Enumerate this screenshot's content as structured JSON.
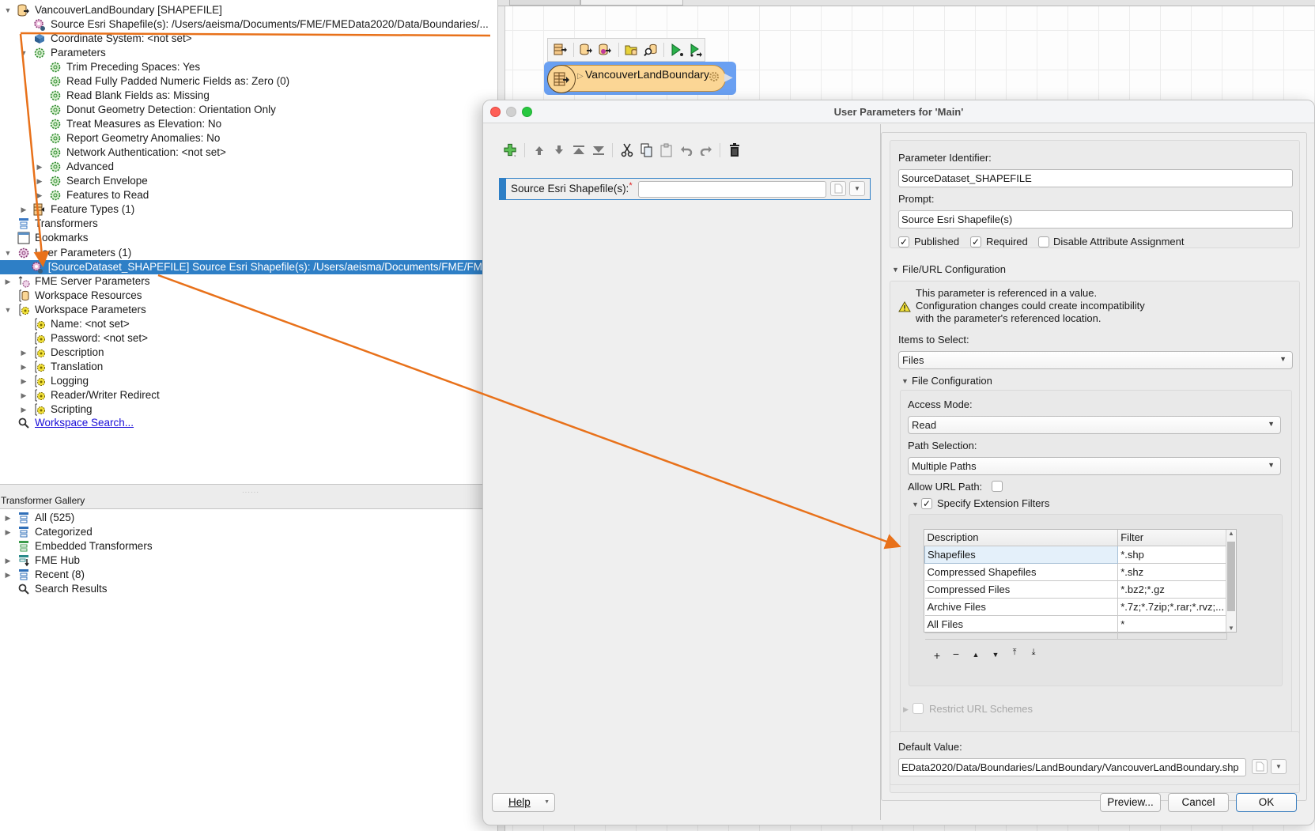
{
  "navigator": {
    "items": [
      {
        "label": "VancouverLandBoundary [SHAPEFILE]",
        "icon": "reader-icon",
        "expanded": true,
        "level": 0
      },
      {
        "label": "Source Esri Shapefile(s): /Users/aeisma/Documents/FME/FMEData2020/Data/Boundaries/...",
        "icon": "user-parameter-icon",
        "level": 1
      },
      {
        "label": "Coordinate System: <not set>",
        "icon": "coordinate-system-icon",
        "level": 1
      },
      {
        "label": "Parameters",
        "icon": "gear-green-icon",
        "expanded": true,
        "level": 1
      },
      {
        "label": "Trim Preceding Spaces: Yes",
        "icon": "gear-green-icon",
        "level": 2
      },
      {
        "label": "Read Fully Padded Numeric Fields as: Zero (0)",
        "icon": "gear-green-icon",
        "level": 2
      },
      {
        "label": "Read Blank Fields as: Missing",
        "icon": "gear-green-icon",
        "level": 2
      },
      {
        "label": "Donut Geometry Detection: Orientation Only",
        "icon": "gear-green-icon",
        "level": 2
      },
      {
        "label": "Treat Measures as Elevation: No",
        "icon": "gear-green-icon",
        "level": 2
      },
      {
        "label": "Report Geometry Anomalies: No",
        "icon": "gear-green-icon",
        "level": 2
      },
      {
        "label": "Network Authentication: <not set>",
        "icon": "gear-green-icon",
        "level": 2
      },
      {
        "label": "Advanced",
        "icon": "gear-green-icon",
        "collapsed": true,
        "level": 2
      },
      {
        "label": "Search Envelope",
        "icon": "gear-green-icon",
        "collapsed": true,
        "level": 2
      },
      {
        "label": "Features to Read",
        "icon": "gear-green-icon",
        "collapsed": true,
        "level": 2
      },
      {
        "label": "Feature Types (1)",
        "icon": "feature-type-icon",
        "collapsed": true,
        "level": 1
      },
      {
        "label": "Transformers",
        "icon": "transformers-icon",
        "level": 0
      },
      {
        "label": "Bookmarks",
        "icon": "bookmarks-icon",
        "level": 0
      },
      {
        "label": "User Parameters (1)",
        "icon": "gear-purple-icon",
        "expanded": true,
        "level": 0
      },
      {
        "label": "[SourceDataset_SHAPEFILE] Source Esri Shapefile(s): /Users/aeisma/Documents/FME/FM",
        "icon": "user-parameter-icon",
        "level": 1,
        "selected": true
      },
      {
        "label": "FME Server Parameters",
        "icon": "server-parameters-icon",
        "collapsed": true,
        "level": 0
      },
      {
        "label": "Workspace Resources",
        "icon": "workspace-resources-icon",
        "level": 0
      },
      {
        "label": "Workspace Parameters",
        "icon": "workspace-parameters-icon",
        "expanded": true,
        "level": 0
      },
      {
        "label": "Name: <not set>",
        "icon": "workspace-parameters-icon",
        "level": 1
      },
      {
        "label": "Password: <not set>",
        "icon": "workspace-parameters-icon",
        "level": 1
      },
      {
        "label": "Description",
        "icon": "workspace-parameters-icon",
        "collapsed": true,
        "level": 1
      },
      {
        "label": "Translation",
        "icon": "workspace-parameters-icon",
        "collapsed": true,
        "level": 1
      },
      {
        "label": "Logging",
        "icon": "workspace-parameters-icon",
        "collapsed": true,
        "level": 1
      },
      {
        "label": "Reader/Writer Redirect",
        "icon": "workspace-parameters-icon",
        "collapsed": true,
        "level": 1
      },
      {
        "label": "Scripting",
        "icon": "workspace-parameters-icon",
        "collapsed": true,
        "level": 1
      }
    ],
    "search_link": "Workspace Search..."
  },
  "gallery": {
    "title": "Transformer Gallery",
    "items": [
      {
        "label": "All (525)",
        "collapsed": true
      },
      {
        "label": "Categorized",
        "collapsed": true
      },
      {
        "label": "Embedded Transformers"
      },
      {
        "label": "FME Hub",
        "collapsed": true
      },
      {
        "label": "Recent (8)",
        "collapsed": true
      },
      {
        "label": "Search Results"
      }
    ]
  },
  "canvas": {
    "node_label": "VancouverLandBoundary"
  },
  "dialog": {
    "title": "User Parameters for 'Main'",
    "parameter_row": {
      "label": "Source Esri Shapefile(s):",
      "required_marker": "*",
      "value": ""
    },
    "form": {
      "identifier_label": "Parameter Identifier:",
      "identifier_value": "SourceDataset_SHAPEFILE",
      "prompt_label": "Prompt:",
      "prompt_value": "Source Esri Shapefile(s)",
      "published_label": "Published",
      "published": true,
      "required_label": "Required",
      "required": true,
      "disable_attr_label": "Disable Attribute Assignment",
      "disable_attr": false,
      "file_url_section": "File/URL Configuration",
      "warning_lines": [
        "This parameter is referenced in a value.",
        "Configuration changes could create incompatibility",
        "with the parameter's referenced location."
      ],
      "items_to_select_label": "Items to Select:",
      "items_to_select_value": "Files",
      "file_config_section": "File Configuration",
      "access_mode_label": "Access Mode:",
      "access_mode_value": "Read",
      "path_selection_label": "Path Selection:",
      "path_selection_value": "Multiple Paths",
      "allow_url_label": "Allow URL Path:",
      "allow_url": false,
      "ext_filters_label": "Specify Extension Filters",
      "ext_filters": true,
      "filter_table": {
        "columns": [
          "Description",
          "Filter"
        ],
        "rows": [
          [
            "Shapefiles",
            "*.shp"
          ],
          [
            "Compressed Shapefiles",
            "*.shz"
          ],
          [
            "Compressed Files",
            "*.bz2;*.gz"
          ],
          [
            "Archive Files",
            "*.7z;*.7zip;*.rar;*.rvz;..."
          ],
          [
            "All Files",
            "*"
          ]
        ]
      },
      "restrict_url_label": "Restrict URL Schemes",
      "default_value_label": "Default Value:",
      "default_value": "EData2020/Data/Boundaries/LandBoundary/VancouverLandBoundary.shp"
    },
    "buttons": {
      "help": "Help",
      "preview": "Preview...",
      "cancel": "Cancel",
      "ok": "OK"
    }
  },
  "colors": {
    "selection": "#2e7fc6",
    "annotation_arrow": "#e8711a",
    "node_highlight": "#6aa0f2",
    "node_fill": "#fbd695"
  }
}
